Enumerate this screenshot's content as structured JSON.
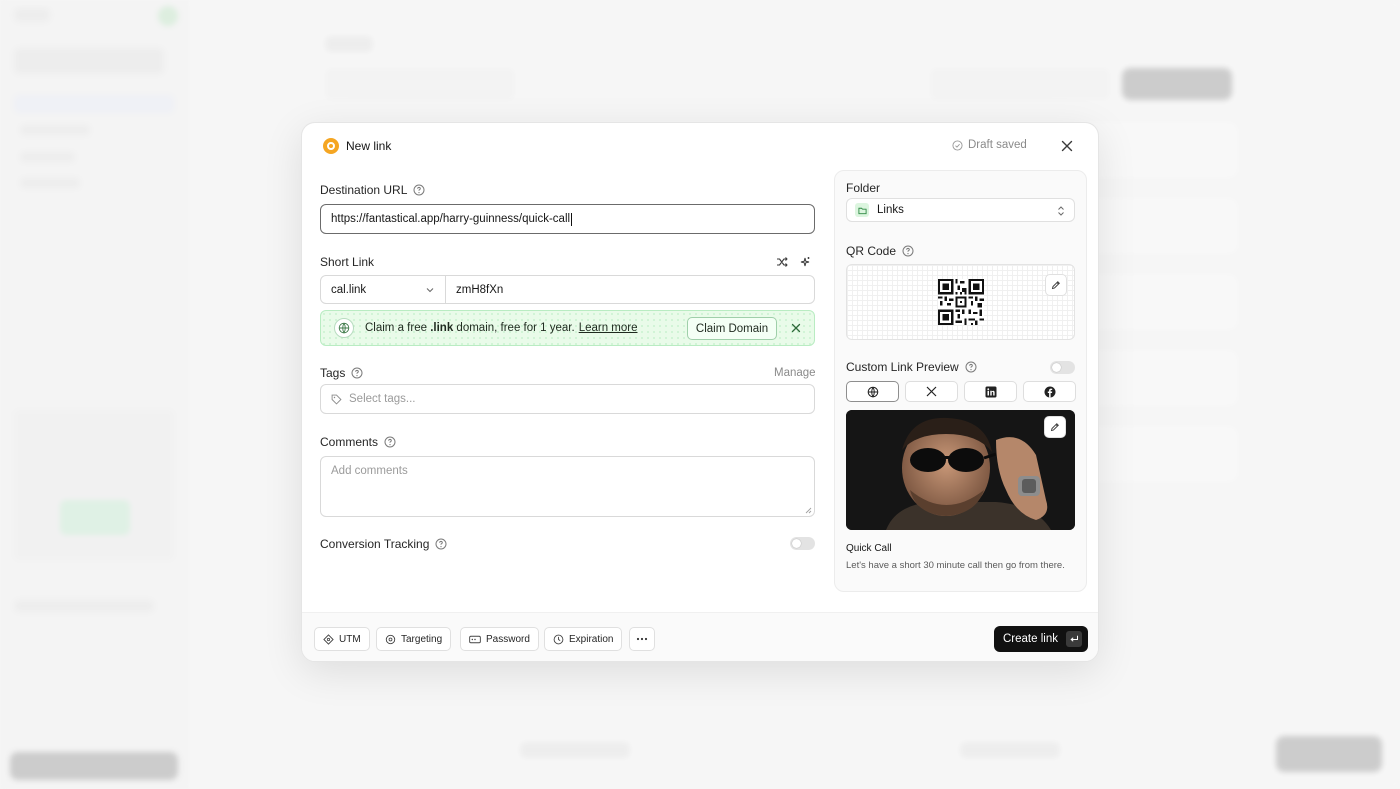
{
  "modal": {
    "title": "New link",
    "draft_status": "Draft saved"
  },
  "destination": {
    "label": "Destination URL",
    "value": "https://fantastical.app/harry-guinness/quick-call"
  },
  "short_link": {
    "label": "Short Link",
    "domain": "cal.link",
    "key": "zmH8fXn"
  },
  "promo": {
    "text_before": "Claim a free",
    "text_bold": ".link",
    "text_after": "domain, free for 1 year.",
    "link_label": "Learn more",
    "button_label": "Claim Domain"
  },
  "tags": {
    "label": "Tags",
    "manage_label": "Manage",
    "placeholder": "Select tags..."
  },
  "comments": {
    "label": "Comments",
    "placeholder": "Add comments"
  },
  "conversion": {
    "label": "Conversion Tracking",
    "enabled": false
  },
  "folder": {
    "label": "Folder",
    "value": "Links"
  },
  "qr": {
    "label": "QR Code"
  },
  "preview": {
    "label": "Custom Link Preview",
    "enabled": false,
    "platforms": [
      "globe-icon",
      "x-icon",
      "linkedin-icon",
      "facebook-icon"
    ],
    "title": "Quick Call",
    "description": "Let's have a short 30 minute call then go from there."
  },
  "footer": {
    "utm": "UTM",
    "targeting": "Targeting",
    "password": "Password",
    "expiration": "Expiration",
    "create": "Create link"
  },
  "colors": {
    "accent": "#111111",
    "logo": "#f5a623",
    "promo_bg": "#e9fbe9"
  }
}
